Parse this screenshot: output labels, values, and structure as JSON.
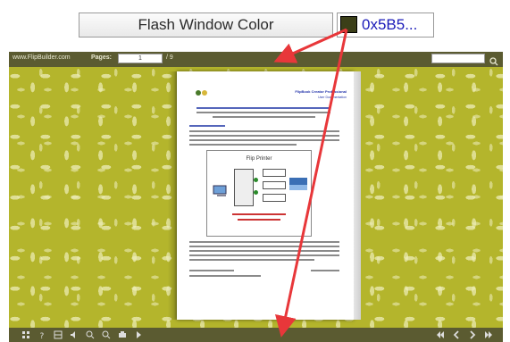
{
  "callout": {
    "label": "Flash Window Color",
    "value": "0x5B5...",
    "swatch_color": "#3b3f18",
    "arrow_color": "#e8373a"
  },
  "topbar": {
    "site": "www.FlipBuilder.com",
    "pages_label": "Pages:",
    "current_page": "1",
    "total_pages": "/ 9",
    "bar_color": "#5b5b31"
  },
  "document": {
    "title": "FlipBook Creator Professional",
    "subtitle": "User Documentation"
  },
  "diagram": {
    "title": "Flip Printer"
  },
  "stage": {
    "background_color": "#b4b52c"
  },
  "icons": {
    "bottom_left": [
      "thumbnails-icon",
      "help-icon",
      "grid-icon",
      "sound-icon",
      "zoom-in-icon",
      "zoom-out-icon",
      "print-icon",
      "autoflip-icon"
    ],
    "bottom_right": [
      "first-page-icon",
      "previous-page-icon",
      "next-page-icon",
      "last-page-icon"
    ]
  }
}
